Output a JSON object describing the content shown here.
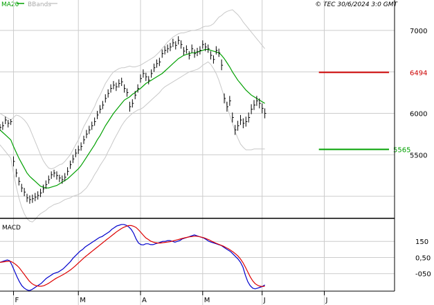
{
  "header": {
    "legend_ma": "MA20",
    "legend_bb": "BBands",
    "copyright": "© TEC 30/6/2024 3:0 GMT"
  },
  "colors": {
    "background": "#ffffff",
    "grid": "#cccccc",
    "price_bars": "#000000",
    "ma20": "#00a000",
    "bbands": "#c8c8c8",
    "macd": "#0000cc",
    "signal": "#dd0000",
    "resistance": "#cc0000",
    "support": "#00a000",
    "axis": "#000000",
    "legend_ma": "#00a000",
    "legend_bb": "#aaaaaa"
  },
  "chart_data": [
    {
      "type": "ohlc",
      "title": "",
      "x_labels": [
        "F",
        "M",
        "A",
        "M",
        "J",
        "J"
      ],
      "y_ticks": [
        5500,
        6000,
        6500,
        7000
      ],
      "y_tick_labels": [
        "5500",
        "6000",
        "",
        "7000"
      ],
      "ylim": [
        4750,
        7250
      ],
      "x_range_index": [
        0,
        146
      ],
      "month_start_index": [
        5,
        29,
        52,
        75,
        97,
        120
      ],
      "grid": true,
      "levels": [
        {
          "name": "resistance",
          "label": "6494",
          "value": 6494,
          "x_from": 118
        },
        {
          "name": "support",
          "label": "5565",
          "value": 5565,
          "x_from": 118
        }
      ],
      "close": [
        5830,
        5850,
        5920,
        5880,
        5900,
        5420,
        5280,
        5180,
        5100,
        5050,
        4980,
        4960,
        4970,
        4990,
        5010,
        5040,
        5090,
        5140,
        5200,
        5260,
        5280,
        5250,
        5220,
        5200,
        5230,
        5300,
        5380,
        5450,
        5520,
        5560,
        5600,
        5680,
        5750,
        5800,
        5850,
        5900,
        5980,
        6050,
        6100,
        6180,
        6240,
        6300,
        6340,
        6320,
        6360,
        6380,
        6300,
        6250,
        6080,
        6120,
        6220,
        6300,
        6420,
        6480,
        6440,
        6400,
        6480,
        6550,
        6600,
        6620,
        6720,
        6760,
        6780,
        6800,
        6850,
        6820,
        6880,
        6830,
        6750,
        6770,
        6700,
        6780,
        6720,
        6740,
        6760,
        6830,
        6800,
        6780,
        6700,
        6650,
        6760,
        6730,
        6580,
        6180,
        6080,
        6150,
        5950,
        5800,
        5850,
        5920,
        5880,
        5900,
        5950,
        6050,
        6100,
        6150,
        6120,
        6060,
        6000
      ],
      "high": [
        5870,
        5900,
        5960,
        5920,
        5930,
        5480,
        5330,
        5230,
        5150,
        5100,
        5030,
        5010,
        5020,
        5040,
        5060,
        5090,
        5140,
        5190,
        5250,
        5300,
        5320,
        5300,
        5260,
        5250,
        5280,
        5350,
        5430,
        5500,
        5570,
        5610,
        5650,
        5730,
        5800,
        5850,
        5900,
        5950,
        6030,
        6100,
        6150,
        6230,
        6290,
        6350,
        6390,
        6370,
        6410,
        6430,
        6350,
        6300,
        6140,
        6170,
        6270,
        6350,
        6470,
        6530,
        6490,
        6450,
        6530,
        6600,
        6650,
        6670,
        6770,
        6810,
        6830,
        6850,
        6900,
        6870,
        6930,
        6880,
        6800,
        6820,
        6750,
        6830,
        6770,
        6790,
        6810,
        6880,
        6850,
        6830,
        6750,
        6700,
        6810,
        6780,
        6650,
        6240,
        6140,
        6210,
        6010,
        5860,
        5910,
        5980,
        5940,
        5960,
        6010,
        6110,
        6160,
        6210,
        6180,
        6120,
        6060
      ],
      "low": [
        5790,
        5800,
        5870,
        5830,
        5860,
        5360,
        5230,
        5130,
        5050,
        5000,
        4930,
        4910,
        4920,
        4940,
        4960,
        4990,
        5040,
        5090,
        5150,
        5210,
        5230,
        5200,
        5170,
        5150,
        5180,
        5250,
        5330,
        5400,
        5470,
        5510,
        5550,
        5630,
        5700,
        5750,
        5800,
        5850,
        5930,
        6000,
        6050,
        6130,
        6190,
        6250,
        6290,
        6270,
        6310,
        6330,
        6250,
        6200,
        6020,
        6070,
        6170,
        6250,
        6370,
        6430,
        6390,
        6350,
        6430,
        6500,
        6550,
        6570,
        6670,
        6710,
        6730,
        6750,
        6800,
        6770,
        6830,
        6780,
        6700,
        6720,
        6650,
        6730,
        6670,
        6690,
        6710,
        6780,
        6750,
        6730,
        6650,
        6600,
        6710,
        6680,
        6520,
        6120,
        6020,
        6090,
        5890,
        5740,
        5790,
        5860,
        5820,
        5840,
        5890,
        5990,
        6040,
        6090,
        6060,
        6000,
        5940
      ],
      "ma20": [
        5800,
        5770,
        5740,
        5710,
        5680,
        5600,
        5530,
        5460,
        5400,
        5340,
        5280,
        5240,
        5210,
        5180,
        5150,
        5120,
        5110,
        5100,
        5100,
        5110,
        5120,
        5130,
        5150,
        5170,
        5190,
        5210,
        5240,
        5270,
        5300,
        5330,
        5370,
        5420,
        5470,
        5520,
        5570,
        5620,
        5680,
        5730,
        5790,
        5850,
        5900,
        5950,
        6000,
        6040,
        6080,
        6120,
        6160,
        6180,
        6200,
        6230,
        6250,
        6280,
        6300,
        6330,
        6360,
        6380,
        6400,
        6420,
        6440,
        6460,
        6480,
        6510,
        6540,
        6570,
        6600,
        6630,
        6660,
        6680,
        6700,
        6710,
        6720,
        6730,
        6730,
        6740,
        6750,
        6760,
        6770,
        6770,
        6760,
        6750,
        6740,
        6730,
        6700,
        6660,
        6610,
        6560,
        6500,
        6450,
        6400,
        6360,
        6320,
        6280,
        6250,
        6220,
        6200,
        6180,
        6160,
        6140,
        6120
      ],
      "bb_upper": [
        6000,
        5980,
        5960,
        5940,
        5920,
        5950,
        5980,
        5970,
        5950,
        5920,
        5880,
        5820,
        5740,
        5660,
        5580,
        5500,
        5430,
        5380,
        5340,
        5330,
        5340,
        5360,
        5380,
        5390,
        5420,
        5460,
        5500,
        5560,
        5620,
        5680,
        5760,
        5840,
        5900,
        5960,
        6020,
        6080,
        6160,
        6220,
        6290,
        6360,
        6410,
        6460,
        6500,
        6520,
        6540,
        6550,
        6550,
        6560,
        6570,
        6560,
        6560,
        6570,
        6580,
        6600,
        6620,
        6640,
        6660,
        6680,
        6710,
        6740,
        6780,
        6820,
        6860,
        6890,
        6920,
        6940,
        6960,
        6970,
        6970,
        6980,
        6990,
        7000,
        7000,
        7010,
        7020,
        7040,
        7050,
        7050,
        7060,
        7080,
        7120,
        7160,
        7180,
        7210,
        7230,
        7240,
        7250,
        7220,
        7190,
        7150,
        7100,
        7060,
        7020,
        6980,
        6940,
        6900,
        6860,
        6820,
        6780
      ],
      "bb_lower": [
        5620,
        5580,
        5540,
        5500,
        5460,
        5280,
        5120,
        4980,
        4870,
        4790,
        4730,
        4700,
        4690,
        4720,
        4760,
        4790,
        4810,
        4830,
        4860,
        4880,
        4900,
        4910,
        4920,
        4940,
        4960,
        4970,
        4980,
        5000,
        5010,
        5020,
        5040,
        5070,
        5100,
        5150,
        5200,
        5260,
        5310,
        5370,
        5420,
        5470,
        5540,
        5600,
        5670,
        5730,
        5790,
        5850,
        5900,
        5940,
        5970,
        6000,
        6020,
        6040,
        6050,
        6070,
        6100,
        6130,
        6160,
        6190,
        6220,
        6250,
        6290,
        6320,
        6340,
        6360,
        6380,
        6400,
        6420,
        6440,
        6460,
        6480,
        6500,
        6510,
        6520,
        6530,
        6550,
        6580,
        6600,
        6620,
        6590,
        6540,
        6480,
        6400,
        6300,
        6200,
        6090,
        5980,
        5880,
        5780,
        5700,
        5630,
        5590,
        5560,
        5560,
        5560,
        5570,
        5570,
        5570,
        5570,
        5570
      ]
    },
    {
      "type": "line",
      "title": "MACD",
      "y_ticks": [
        150,
        50,
        -50
      ],
      "y_tick_labels": [
        "150",
        "0,50",
        "-050"
      ],
      "ylim": [
        -150,
        280
      ],
      "series": [
        {
          "name": "MACD",
          "color_key": "macd",
          "values": [
            20,
            25,
            30,
            35,
            30,
            0,
            -35,
            -70,
            -100,
            -125,
            -140,
            -150,
            -155,
            -150,
            -140,
            -130,
            -120,
            -110,
            -95,
            -80,
            -70,
            -60,
            -50,
            -45,
            -40,
            -30,
            -20,
            -5,
            10,
            25,
            45,
            60,
            75,
            90,
            100,
            115,
            125,
            135,
            145,
            155,
            165,
            175,
            180,
            190,
            200,
            210,
            225,
            235,
            245,
            250,
            255,
            255,
            250,
            240,
            225,
            200,
            165,
            140,
            130,
            128,
            135,
            135,
            130,
            130,
            135,
            140,
            145,
            150,
            150,
            155,
            155,
            150,
            145,
            150,
            155,
            165,
            170,
            175,
            180,
            185,
            190,
            185,
            180,
            175,
            170,
            160,
            150,
            145,
            140,
            135,
            130,
            125,
            115,
            105,
            95,
            85,
            70,
            55,
            40,
            20,
            -10,
            -60,
            -100,
            -125,
            -140,
            -145,
            -140,
            -135,
            -130,
            -120
          ]
        },
        {
          "name": "Signal",
          "color_key": "signal",
          "values": [
            20,
            22,
            24,
            26,
            27,
            22,
            12,
            0,
            -15,
            -35,
            -55,
            -75,
            -95,
            -110,
            -120,
            -125,
            -128,
            -128,
            -125,
            -118,
            -110,
            -100,
            -90,
            -80,
            -72,
            -64,
            -56,
            -47,
            -37,
            -27,
            -15,
            -2,
            12,
            26,
            40,
            54,
            66,
            78,
            90,
            102,
            114,
            126,
            138,
            150,
            162,
            174,
            186,
            198,
            210,
            220,
            230,
            238,
            244,
            248,
            248,
            244,
            236,
            222,
            205,
            188,
            172,
            162,
            152,
            146,
            142,
            140,
            140,
            142,
            144,
            146,
            148,
            152,
            156,
            160,
            164,
            168,
            172,
            175,
            178,
            180,
            182,
            182,
            180,
            176,
            172,
            166,
            160,
            152,
            145,
            138,
            132,
            126,
            120,
            112,
            104,
            94,
            84,
            72,
            58,
            40,
            18,
            -10,
            -40,
            -70,
            -95,
            -112,
            -122,
            -128,
            -130,
            -128
          ]
        }
      ]
    }
  ]
}
